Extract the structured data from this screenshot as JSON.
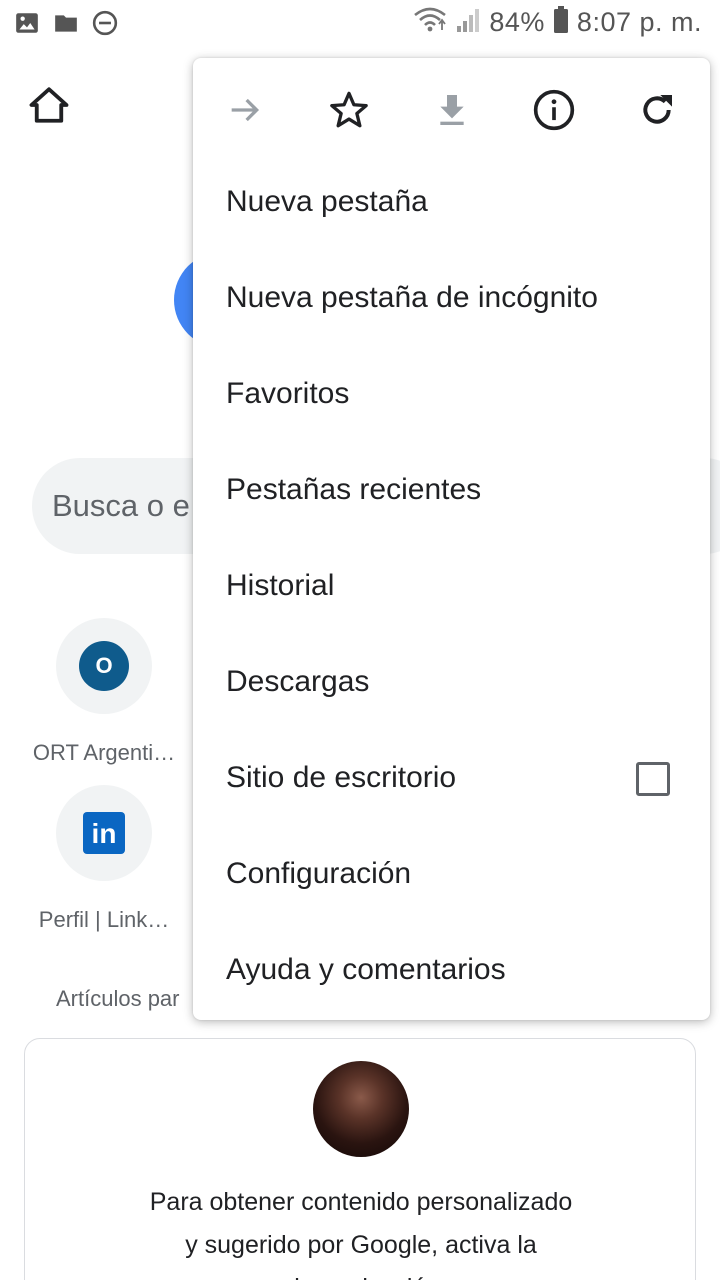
{
  "status_bar": {
    "battery": "84%",
    "time": "8:07 p. m.",
    "icons": [
      "image-icon",
      "folder-icon",
      "do-not-disturb-icon",
      "wifi-icon",
      "signal-icon",
      "battery-icon"
    ]
  },
  "page": {
    "search_placeholder": "Busca o e",
    "tiles": [
      {
        "label": "ORT Argenti…",
        "badge": "O",
        "icon": "ort-site-icon"
      },
      {
        "label": "Perfil | Link…",
        "badge": "in",
        "icon": "linkedin-icon"
      }
    ],
    "articles_heading": "Artículos par",
    "card_text_line1": "Para obtener contenido personalizado",
    "card_text_line2": "y sugerido por Google, activa la",
    "card_text_line3": "sincronización"
  },
  "menu": {
    "toolbar": [
      "forward-icon",
      "bookmark-star-icon",
      "download-icon",
      "page-info-icon",
      "reload-icon"
    ],
    "items": [
      {
        "label": "Nueva pestaña"
      },
      {
        "label": "Nueva pestaña de incógnito"
      },
      {
        "label": "Favoritos"
      },
      {
        "label": "Pestañas recientes"
      },
      {
        "label": "Historial"
      },
      {
        "label": "Descargas"
      },
      {
        "label": "Sitio de escritorio",
        "checked": false
      },
      {
        "label": "Configuración"
      },
      {
        "label": "Ayuda y comentarios"
      }
    ]
  },
  "colors": {
    "accent_blue": "#4285F4",
    "linkedin_blue": "#0a66c2",
    "ort_blue": "#0f5b8c",
    "text_primary": "#202124",
    "text_secondary": "#5f6368"
  }
}
